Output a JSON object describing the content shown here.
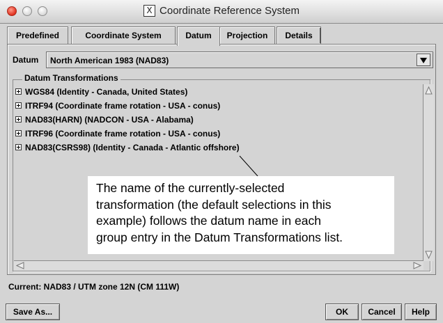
{
  "window": {
    "title": "Coordinate Reference System",
    "title_icon": "x11-icon"
  },
  "tabs": [
    {
      "label": "Predefined",
      "active": false
    },
    {
      "label": "Coordinate System",
      "active": false
    },
    {
      "label": "Datum",
      "active": true
    },
    {
      "label": "Projection",
      "active": false
    },
    {
      "label": "Details",
      "active": false
    }
  ],
  "datum": {
    "label": "Datum",
    "selected": "North American 1983 (NAD83)"
  },
  "transformations": {
    "group_title": "Datum Transformations",
    "items": [
      "WGS84 (Identity - Canada, United States)",
      "ITRF94 (Coordinate frame rotation - USA - conus)",
      "NAD83(HARN) (NADCON - USA - Alabama)",
      "ITRF96 (Coordinate frame rotation - USA - conus)",
      "NAD83(CSRS98) (Identity - Canada - Atlantic offshore)"
    ]
  },
  "callout": {
    "lines": [
      "The name of the currently-selected",
      "transformation (the default selections in this",
      "example) follows the datum name in each",
      "group entry in the Datum Transformations list."
    ]
  },
  "status": {
    "current": "Current: NAD83 / UTM zone 12N (CM 111W)"
  },
  "buttons": {
    "save_as": "Save As...",
    "ok": "OK",
    "cancel": "Cancel",
    "help": "Help"
  }
}
